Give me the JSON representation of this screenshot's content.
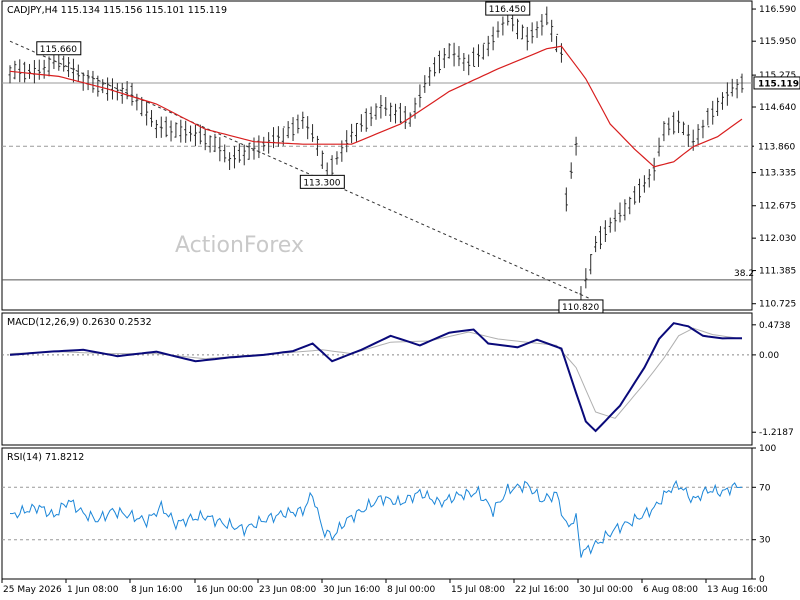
{
  "colors": {
    "price": "#2b2b2b",
    "ma": "#d81e1e",
    "macd": "#0a0a7a",
    "signal": "#b0b0b0",
    "rsi": "#1c86d8",
    "bg": "#ffffff"
  },
  "chart_data": [
    {
      "type": "line",
      "title": "CADJPY,H4  115.134 115.156 115.101 115.119",
      "watermark": "ActionForex",
      "ylim": [
        110.6,
        116.75
      ],
      "yticks": [
        "116.590",
        "115.950",
        "115.275",
        "114.640",
        "113.860",
        "113.335",
        "112.675",
        "112.030",
        "111.385",
        "110.725"
      ],
      "xticks": [
        "25 May 2026",
        "1 Jun 08:00",
        "8 Jun 16:00",
        "16 Jun 00:00",
        "23 Jun 08:00",
        "30 Jun 16:00",
        "8 Jul 00:00",
        "15 Jul 08:00",
        "22 Jul 16:00",
        "30 Jul 00:00",
        "6 Aug 08:00",
        "13 Aug 16:00"
      ],
      "price_keys": [
        [
          0,
          115.35
        ],
        [
          6,
          115.35
        ],
        [
          10,
          115.6
        ],
        [
          15,
          115.2
        ],
        [
          20,
          115.0
        ],
        [
          25,
          114.9
        ],
        [
          30,
          114.25
        ],
        [
          38,
          114.1
        ],
        [
          42,
          113.9
        ],
        [
          45,
          113.6
        ],
        [
          50,
          113.8
        ],
        [
          55,
          114.05
        ],
        [
          58,
          114.2
        ],
        [
          60,
          114.4
        ],
        [
          63,
          113.9
        ],
        [
          65,
          113.3
        ],
        [
          70,
          114.1
        ],
        [
          76,
          114.65
        ],
        [
          82,
          114.4
        ],
        [
          86,
          115.3
        ],
        [
          90,
          115.75
        ],
        [
          94,
          115.5
        ],
        [
          98,
          115.85
        ],
        [
          102,
          116.45
        ],
        [
          106,
          116.0
        ],
        [
          110,
          116.4
        ],
        [
          113,
          115.7
        ],
        [
          114,
          112.8
        ],
        [
          116,
          113.9
        ],
        [
          117,
          110.85
        ],
        [
          120,
          111.9
        ],
        [
          123,
          112.3
        ],
        [
          126,
          112.6
        ],
        [
          130,
          113.1
        ],
        [
          132,
          113.4
        ],
        [
          134,
          114.2
        ],
        [
          137,
          114.35
        ],
        [
          140,
          113.95
        ],
        [
          143,
          114.4
        ],
        [
          147,
          114.9
        ],
        [
          150,
          115.119
        ]
      ],
      "ma_keys": [
        [
          0,
          115.35
        ],
        [
          10,
          115.25
        ],
        [
          20,
          115.0
        ],
        [
          30,
          114.7
        ],
        [
          40,
          114.2
        ],
        [
          50,
          113.95
        ],
        [
          60,
          113.9
        ],
        [
          70,
          113.9
        ],
        [
          80,
          114.3
        ],
        [
          90,
          114.95
        ],
        [
          100,
          115.4
        ],
        [
          110,
          115.8
        ],
        [
          113,
          115.85
        ],
        [
          118,
          115.2
        ],
        [
          123,
          114.3
        ],
        [
          128,
          113.8
        ],
        [
          132,
          113.45
        ],
        [
          136,
          113.55
        ],
        [
          140,
          113.85
        ],
        [
          145,
          114.05
        ],
        [
          150,
          114.4
        ]
      ],
      "hlines": [
        {
          "value": 115.119,
          "style": "solid",
          "label": "115.119"
        },
        {
          "value": 113.86,
          "style": "dash",
          "label": "113.860"
        },
        {
          "value": 111.2,
          "style": "solid",
          "label": "38.2"
        }
      ],
      "trendline": [
        [
          0,
          115.95
        ],
        [
          119,
          110.82
        ]
      ],
      "annotations": [
        {
          "text": "115.660",
          "x": 10,
          "y": 115.66
        },
        {
          "text": "113.300",
          "x": 64,
          "y": 113.3
        },
        {
          "text": "116.450",
          "x": 102,
          "y": 116.45
        },
        {
          "text": "110.820",
          "x": 117,
          "y": 110.82
        }
      ]
    },
    {
      "type": "line",
      "title": "MACD(12,26,9) 0.2630 0.2532",
      "ylim": [
        -1.42,
        0.66
      ],
      "yticks": [
        "0.4738",
        "0.00",
        "-1.2187"
      ],
      "macd_keys": [
        [
          0,
          0.0
        ],
        [
          8,
          0.05
        ],
        [
          15,
          0.08
        ],
        [
          22,
          -0.02
        ],
        [
          30,
          0.05
        ],
        [
          38,
          -0.1
        ],
        [
          45,
          -0.04
        ],
        [
          52,
          0.0
        ],
        [
          58,
          0.06
        ],
        [
          62,
          0.18
        ],
        [
          66,
          -0.1
        ],
        [
          72,
          0.08
        ],
        [
          78,
          0.3
        ],
        [
          84,
          0.15
        ],
        [
          90,
          0.35
        ],
        [
          95,
          0.4
        ],
        [
          98,
          0.18
        ],
        [
          104,
          0.12
        ],
        [
          108,
          0.24
        ],
        [
          113,
          0.1
        ],
        [
          116,
          -0.6
        ],
        [
          118,
          -1.05
        ],
        [
          120,
          -1.2
        ],
        [
          125,
          -0.8
        ],
        [
          130,
          -0.2
        ],
        [
          133,
          0.25
        ],
        [
          136,
          0.5
        ],
        [
          139,
          0.45
        ],
        [
          142,
          0.3
        ],
        [
          146,
          0.26
        ],
        [
          150,
          0.263
        ]
      ],
      "signal_keys": [
        [
          0,
          0.02
        ],
        [
          10,
          0.05
        ],
        [
          20,
          0.02
        ],
        [
          30,
          0.02
        ],
        [
          40,
          -0.06
        ],
        [
          50,
          0.0
        ],
        [
          58,
          0.04
        ],
        [
          64,
          0.08
        ],
        [
          70,
          0.02
        ],
        [
          78,
          0.2
        ],
        [
          86,
          0.22
        ],
        [
          94,
          0.36
        ],
        [
          100,
          0.25
        ],
        [
          106,
          0.2
        ],
        [
          112,
          0.15
        ],
        [
          116,
          -0.2
        ],
        [
          120,
          -0.9
        ],
        [
          124,
          -1.0
        ],
        [
          130,
          -0.45
        ],
        [
          134,
          -0.05
        ],
        [
          137,
          0.3
        ],
        [
          140,
          0.42
        ],
        [
          144,
          0.32
        ],
        [
          150,
          0.2532
        ]
      ]
    },
    {
      "type": "line",
      "title": "RSI(14) 71.8212",
      "ylim": [
        0,
        100
      ],
      "yticks": [
        "100",
        "70",
        "30",
        "0"
      ],
      "levels": [
        70,
        30
      ],
      "rsi_keys": [
        [
          0,
          48
        ],
        [
          3,
          52
        ],
        [
          6,
          55
        ],
        [
          9,
          48
        ],
        [
          12,
          60
        ],
        [
          15,
          50
        ],
        [
          18,
          45
        ],
        [
          21,
          52
        ],
        [
          25,
          48
        ],
        [
          28,
          44
        ],
        [
          31,
          55
        ],
        [
          34,
          42
        ],
        [
          37,
          46
        ],
        [
          40,
          48
        ],
        [
          44,
          42
        ],
        [
          48,
          38
        ],
        [
          52,
          45
        ],
        [
          56,
          50
        ],
        [
          60,
          52
        ],
        [
          62,
          65
        ],
        [
          64,
          38
        ],
        [
          66,
          32
        ],
        [
          69,
          45
        ],
        [
          72,
          52
        ],
        [
          76,
          62
        ],
        [
          80,
          58
        ],
        [
          84,
          66
        ],
        [
          88,
          58
        ],
        [
          92,
          64
        ],
        [
          96,
          66
        ],
        [
          99,
          52
        ],
        [
          102,
          68
        ],
        [
          106,
          72
        ],
        [
          109,
          60
        ],
        [
          112,
          65
        ],
        [
          114,
          40
        ],
        [
          116,
          46
        ],
        [
          117,
          20
        ],
        [
          120,
          26
        ],
        [
          124,
          38
        ],
        [
          128,
          45
        ],
        [
          132,
          54
        ],
        [
          135,
          68
        ],
        [
          137,
          72
        ],
        [
          140,
          60
        ],
        [
          143,
          68
        ],
        [
          146,
          66
        ],
        [
          148,
          70
        ],
        [
          150,
          71.8
        ]
      ]
    }
  ]
}
